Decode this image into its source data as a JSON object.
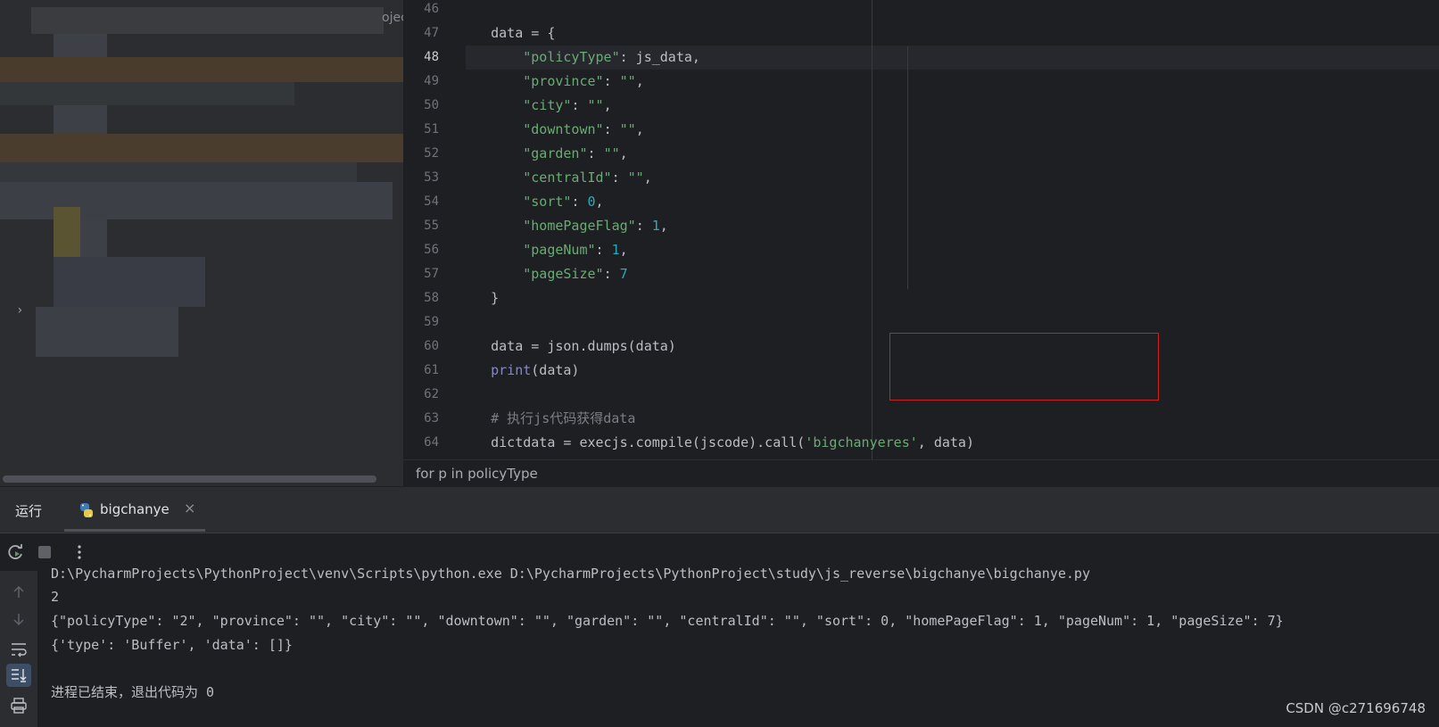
{
  "project_panel": {
    "edge_text": "ojec",
    "expand_glyph": "›"
  },
  "editor": {
    "current_line": 48,
    "line_numbers": [
      "46",
      "47",
      "48",
      "49",
      "50",
      "51",
      "52",
      "53",
      "54",
      "55",
      "56",
      "57",
      "58",
      "59",
      "60",
      "61",
      "62",
      "63",
      "64"
    ],
    "lines": [
      [],
      [
        {
          "t": "    data = {",
          "c": ""
        }
      ],
      [
        {
          "t": "        ",
          "c": ""
        },
        {
          "t": "\"policyType\"",
          "c": "str"
        },
        {
          "t": ": js_data,",
          "c": ""
        }
      ],
      [
        {
          "t": "        ",
          "c": ""
        },
        {
          "t": "\"province\"",
          "c": "str"
        },
        {
          "t": ": ",
          "c": ""
        },
        {
          "t": "\"\"",
          "c": "str"
        },
        {
          "t": ",",
          "c": ""
        }
      ],
      [
        {
          "t": "        ",
          "c": ""
        },
        {
          "t": "\"city\"",
          "c": "str"
        },
        {
          "t": ": ",
          "c": ""
        },
        {
          "t": "\"\"",
          "c": "str"
        },
        {
          "t": ",",
          "c": ""
        }
      ],
      [
        {
          "t": "        ",
          "c": ""
        },
        {
          "t": "\"downtown\"",
          "c": "str"
        },
        {
          "t": ": ",
          "c": ""
        },
        {
          "t": "\"\"",
          "c": "str"
        },
        {
          "t": ",",
          "c": ""
        }
      ],
      [
        {
          "t": "        ",
          "c": ""
        },
        {
          "t": "\"garden\"",
          "c": "str"
        },
        {
          "t": ": ",
          "c": ""
        },
        {
          "t": "\"\"",
          "c": "str"
        },
        {
          "t": ",",
          "c": ""
        }
      ],
      [
        {
          "t": "        ",
          "c": ""
        },
        {
          "t": "\"centralId\"",
          "c": "str"
        },
        {
          "t": ": ",
          "c": ""
        },
        {
          "t": "\"\"",
          "c": "str"
        },
        {
          "t": ",",
          "c": ""
        }
      ],
      [
        {
          "t": "        ",
          "c": ""
        },
        {
          "t": "\"sort\"",
          "c": "str"
        },
        {
          "t": ": ",
          "c": ""
        },
        {
          "t": "0",
          "c": "num"
        },
        {
          "t": ",",
          "c": ""
        }
      ],
      [
        {
          "t": "        ",
          "c": ""
        },
        {
          "t": "\"homePageFlag\"",
          "c": "str"
        },
        {
          "t": ": ",
          "c": ""
        },
        {
          "t": "1",
          "c": "num"
        },
        {
          "t": ",",
          "c": ""
        }
      ],
      [
        {
          "t": "        ",
          "c": ""
        },
        {
          "t": "\"pageNum\"",
          "c": "str"
        },
        {
          "t": ": ",
          "c": ""
        },
        {
          "t": "1",
          "c": "num"
        },
        {
          "t": ",",
          "c": ""
        }
      ],
      [
        {
          "t": "        ",
          "c": ""
        },
        {
          "t": "\"pageSize\"",
          "c": "str"
        },
        {
          "t": ": ",
          "c": ""
        },
        {
          "t": "7",
          "c": "num"
        }
      ],
      [
        {
          "t": "    }",
          "c": ""
        }
      ],
      [],
      [
        {
          "t": "    data = json.dumps(data)",
          "c": ""
        }
      ],
      [
        {
          "t": "    ",
          "c": ""
        },
        {
          "t": "print",
          "c": "fn"
        },
        {
          "t": "(data)",
          "c": ""
        }
      ],
      [],
      [
        {
          "t": "    # 执行js代码获得data",
          "c": "cmt"
        }
      ],
      [
        {
          "t": "    dictdata = execjs.compile(jscode).call(",
          "c": ""
        },
        {
          "t": "'bigchanyeres'",
          "c": "str"
        },
        {
          "t": ", data)",
          "c": ""
        }
      ]
    ],
    "breadcrumb": "for p in policyType"
  },
  "run": {
    "title": "运行",
    "tab_label": "bigchanye",
    "tab_close": "×",
    "console_lines": [
      "D:\\PycharmProjects\\PythonProject\\venv\\Scripts\\python.exe D:\\PycharmProjects\\PythonProject\\study\\js_reverse\\bigchanye\\bigchanye.py",
      "2",
      "{\"policyType\": \"2\", \"province\": \"\", \"city\": \"\", \"downtown\": \"\", \"garden\": \"\", \"centralId\": \"\", \"sort\": 0, \"homePageFlag\": 1, \"pageNum\": 1, \"pageSize\": 7}",
      "{'type': 'Buffer', 'data': []}",
      "",
      "进程已结束，退出代码为 0"
    ]
  },
  "watermark": "CSDN @c271696748",
  "colors": {
    "highlight_border": "#d0201c",
    "string": "#6aab73",
    "number": "#2aacb8",
    "builtin": "#8888c6"
  }
}
